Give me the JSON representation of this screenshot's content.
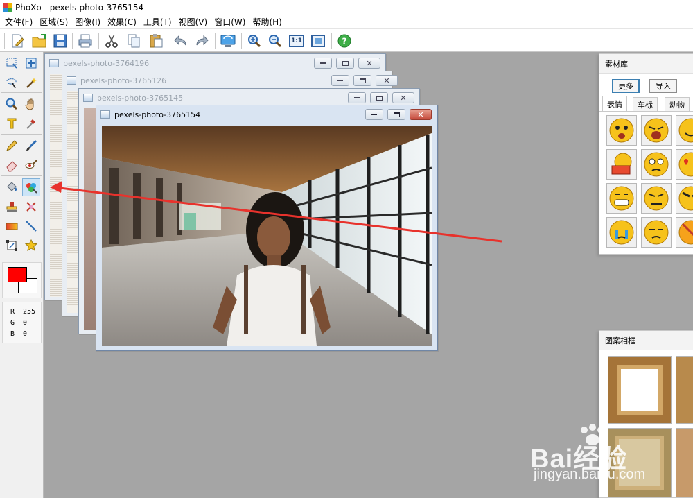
{
  "window": {
    "title": "PhoXo - pexels-photo-3765154"
  },
  "menu": [
    {
      "label": "文件(F)"
    },
    {
      "label": "区域(S)"
    },
    {
      "label": "图像(I)"
    },
    {
      "label": "效果(C)"
    },
    {
      "label": "工具(T)"
    },
    {
      "label": "视图(V)"
    },
    {
      "label": "窗口(W)"
    },
    {
      "label": "帮助(H)"
    }
  ],
  "toolbar": {
    "icons": [
      "new-file-icon",
      "open-folder-icon",
      "save-icon",
      "print-icon",
      "cut-icon",
      "copy-icon",
      "paste-icon",
      "undo-icon",
      "redo-icon",
      "screen-capture-icon",
      "zoom-in-icon",
      "zoom-out-icon",
      "actual-size-icon",
      "fit-window-icon",
      "help-icon"
    ],
    "actual_size_label": "1:1"
  },
  "tools": {
    "selected": "fill-bucket-tool",
    "items": [
      "rect-select",
      "move",
      "lasso",
      "magic-wand",
      "zoom",
      "hand",
      "text",
      "eyedropper",
      "pencil",
      "brush",
      "eraser",
      "red-eye",
      "fill-bucket",
      "color-fill",
      "clone-stamp",
      "smudge",
      "gradient",
      "line",
      "transform",
      "star-shape"
    ]
  },
  "colors": {
    "foreground": "#ff0000",
    "background": "#ffffff"
  },
  "rgb": {
    "r_label": "R",
    "r_value": "255",
    "g_label": "G",
    "g_value": "0",
    "b_label": "B",
    "b_value": "0"
  },
  "documents": [
    {
      "title": "pexels-photo-3764196"
    },
    {
      "title": "pexels-photo-3765126"
    },
    {
      "title": "pexels-photo-3765145"
    },
    {
      "title": "pexels-photo-3765154"
    }
  ],
  "materials_panel": {
    "title": "素材库",
    "more_button": "更多",
    "import_button": "导入",
    "tabs": [
      "表情",
      "车标",
      "动物"
    ],
    "active_tab": "表情"
  },
  "frames_panel": {
    "title": "图案相框"
  },
  "watermark": {
    "main": "Bai经验",
    "sub": "jingyan.baidu.com"
  }
}
